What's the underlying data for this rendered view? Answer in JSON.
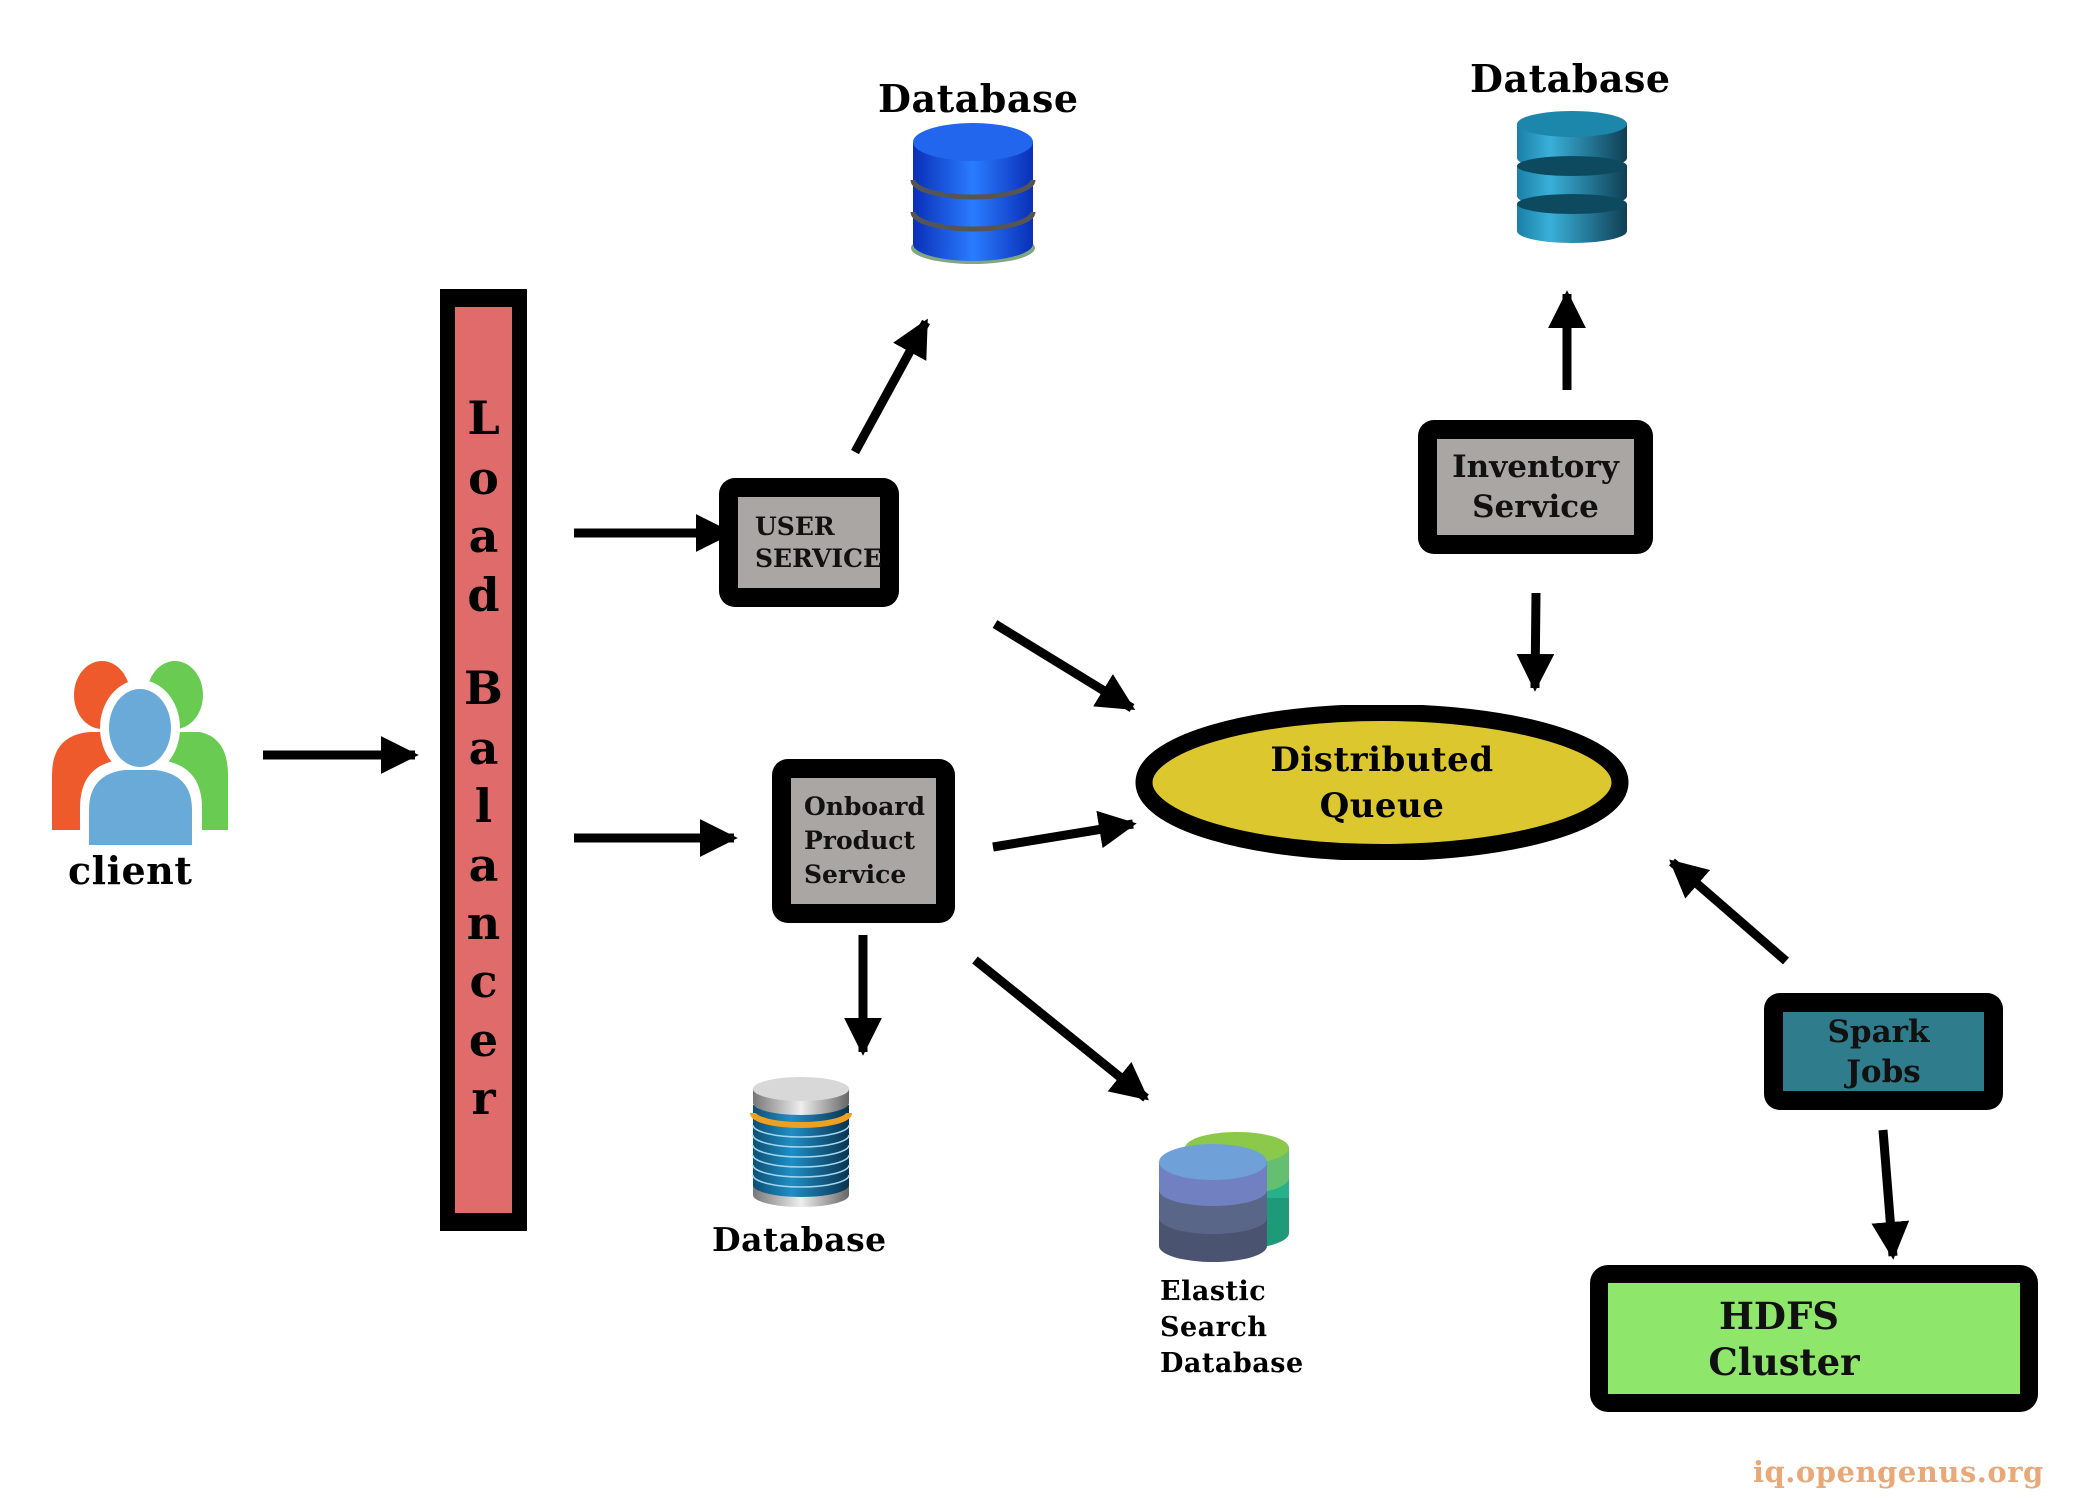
{
  "diagram": {
    "client": {
      "label": "client",
      "icon": "users-icon"
    },
    "load_balancer": {
      "label": "Load Balancer",
      "letters": [
        "L",
        "o",
        "a",
        "d",
        "B",
        "a",
        "l",
        "a",
        "n",
        "c",
        "e",
        "r"
      ],
      "fill": "#e06b6b"
    },
    "user_service": {
      "lines": [
        "USER",
        "SERVICE"
      ],
      "fill": "#a9a6a3"
    },
    "onboard_service": {
      "lines": [
        "Onboard",
        "Product",
        "Service"
      ],
      "fill": "#a9a6a3"
    },
    "inventory_service": {
      "lines": [
        "Inventory",
        "Service"
      ],
      "fill": "#a9a6a3"
    },
    "distributed_queue": {
      "lines": [
        "Distributed",
        "Queue"
      ],
      "fill": "#dcc82e"
    },
    "spark_jobs": {
      "lines": [
        "Spark",
        "Jobs"
      ],
      "fill": "#2f7c8c"
    },
    "hdfs_cluster": {
      "lines": [
        "HDFS",
        "Cluster"
      ],
      "fill": "#8ee66b"
    },
    "db_user": {
      "label": "Database",
      "icon": "database-icon"
    },
    "db_inventory": {
      "label": "Database",
      "icon": "database-icon"
    },
    "db_onboard": {
      "label": "Database",
      "icon": "database-icon"
    },
    "db_elastic": {
      "lines": [
        "Elastic",
        "Search",
        "Database"
      ],
      "icon": "database-icon"
    },
    "edges": [
      {
        "from": "client",
        "to": "load_balancer"
      },
      {
        "from": "load_balancer",
        "to": "user_service"
      },
      {
        "from": "load_balancer",
        "to": "onboard_service"
      },
      {
        "from": "user_service",
        "to": "db_user"
      },
      {
        "from": "user_service",
        "to": "distributed_queue"
      },
      {
        "from": "onboard_service",
        "to": "distributed_queue"
      },
      {
        "from": "onboard_service",
        "to": "db_onboard"
      },
      {
        "from": "onboard_service",
        "to": "db_elastic"
      },
      {
        "from": "inventory_service",
        "to": "db_inventory"
      },
      {
        "from": "inventory_service",
        "to": "distributed_queue"
      },
      {
        "from": "spark_jobs",
        "to": "distributed_queue"
      },
      {
        "from": "spark_jobs",
        "to": "hdfs_cluster"
      }
    ]
  },
  "watermark": {
    "text": "iq.opengenus.org",
    "color": "#e8a878"
  }
}
